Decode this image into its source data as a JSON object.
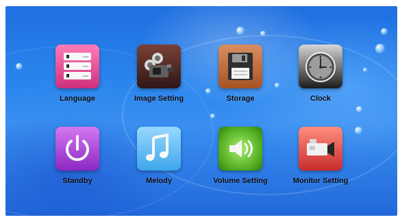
{
  "menu": {
    "items": [
      {
        "label": "Language",
        "icon": "stacked-list-icon"
      },
      {
        "label": "Image Setting",
        "icon": "camera-icon"
      },
      {
        "label": "Storage",
        "icon": "floppy-disk-icon"
      },
      {
        "label": "Clock",
        "icon": "clock-icon"
      },
      {
        "label": "Standby",
        "icon": "power-icon"
      },
      {
        "label": "Melody",
        "icon": "music-note-icon"
      },
      {
        "label": "Volume Setting",
        "icon": "speaker-icon"
      },
      {
        "label": "Monitor Setting",
        "icon": "video-camera-icon"
      }
    ]
  },
  "colors": {
    "background": "#2b86ee",
    "label": "#0a0a12"
  }
}
